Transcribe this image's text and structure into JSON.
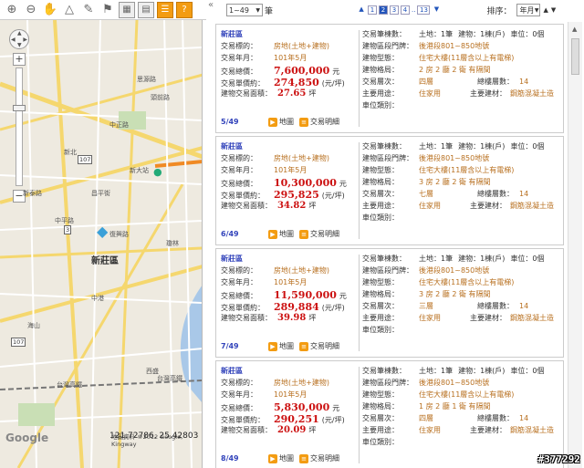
{
  "pager": {
    "range_value": "1~49",
    "range_unit": "筆",
    "pages": [
      "1",
      "2",
      "3",
      "4"
    ],
    "active_page": "2",
    "ellipsis": "..",
    "last_page": "13",
    "sort_label": "排序：",
    "sort_value": "年月"
  },
  "labels": {
    "type": "交易標的：",
    "yearmonth": "交易年月：",
    "total": "交易總價：",
    "unit_price": "交易單價約：",
    "area": "建物交易面積：",
    "count": "交易筆棟數：",
    "address": "建物區段門牌：",
    "building_type": "建物型態：",
    "layout": "建物格局：",
    "floor": "交易層次：",
    "use": "主要用途：",
    "parking": "車位類別：",
    "floors_total": "總樓層數：",
    "material": "主要建材：",
    "currency": "元",
    "per_ping": "(元/坪)",
    "ping": "坪",
    "map_btn": "地圖",
    "detail_btn": "交易明細"
  },
  "listings": [
    {
      "district": "新莊區",
      "type": "房地(土地+建物)",
      "yearmonth": "101年5月",
      "total": "7,600,000",
      "unit_price": "274,850",
      "area": "27.65",
      "index": "5/49",
      "count": [
        "土地：1筆",
        "建物：1棟(戶)",
        "車位：0個"
      ],
      "address": "後港段801~850地號",
      "building_type": "住宅大樓(11層含以上有電梯)",
      "layout": "2 房 2 廳 2 衛 有隔間",
      "floor": "四層",
      "floors_total": "14",
      "use": "住家用",
      "material": "鋼筋混凝土造",
      "parking": ""
    },
    {
      "district": "新莊區",
      "type": "房地(土地+建物)",
      "yearmonth": "101年5月",
      "total": "10,300,000",
      "unit_price": "295,825",
      "area": "34.82",
      "index": "6/49",
      "count": [
        "土地：1筆",
        "建物：1棟(戶)",
        "車位：0個"
      ],
      "address": "後港段801~850地號",
      "building_type": "住宅大樓(11層含以上有電梯)",
      "layout": "3 房 2 廳 2 衛 有隔間",
      "floor": "七層",
      "floors_total": "14",
      "use": "住家用",
      "material": "鋼筋混凝土造",
      "parking": ""
    },
    {
      "district": "新莊區",
      "type": "房地(土地+建物)",
      "yearmonth": "101年5月",
      "total": "11,590,000",
      "unit_price": "289,884",
      "area": "39.98",
      "index": "7/49",
      "count": [
        "土地：1筆",
        "建物：1棟(戶)",
        "車位：0個"
      ],
      "address": "後港段801~850地號",
      "building_type": "住宅大樓(11層含以上有電梯)",
      "layout": "3 房 2 廳 2 衛 有隔間",
      "floor": "三層",
      "floors_total": "14",
      "use": "住家用",
      "material": "鋼筋混凝土造",
      "parking": ""
    },
    {
      "district": "新莊區",
      "type": "房地(土地+建物)",
      "yearmonth": "101年5月",
      "total": "5,830,000",
      "unit_price": "290,251",
      "area": "20.09",
      "index": "8/49",
      "count": [
        "土地：1筆",
        "建物：1棟(戶)",
        "車位：0個"
      ],
      "address": "後港段801~850地號",
      "building_type": "住宅大樓(11層含以上有電梯)",
      "layout": "1 房 2 廳 1 衛 有隔間",
      "floor": "四層",
      "floors_total": "14",
      "use": "住家用",
      "material": "鋼筋混凝土造",
      "parking": ""
    }
  ],
  "map": {
    "coords": "121.72786, 25.42803",
    "credit": "地圖資料 ©2012 Google, Kingway",
    "google": "Google",
    "district_label": "新莊區",
    "labels": [
      "中正路",
      "思源路",
      "頭前路",
      "中平路",
      "昌平街",
      "新泰路",
      "復興路",
      "瓊林",
      "新北",
      "西盛",
      "台灣高鐵",
      "台灣高鐵",
      "中港",
      "新大站",
      "海山",
      "新莊區"
    ],
    "routes": [
      "107",
      "107",
      "3"
    ]
  },
  "watermark": "#377292"
}
